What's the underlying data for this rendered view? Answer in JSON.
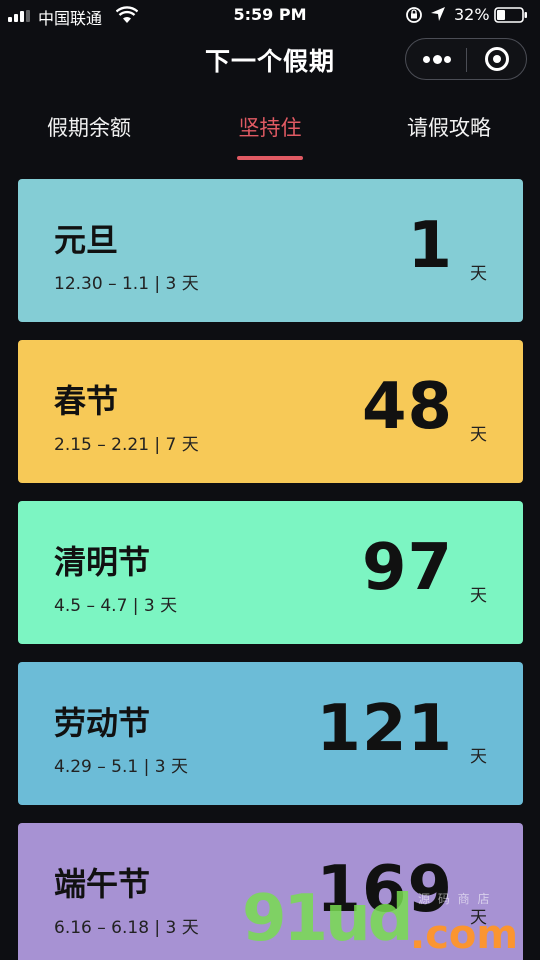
{
  "status_bar": {
    "carrier": "中国联通",
    "time": "5:59 PM",
    "battery": "32%"
  },
  "header": {
    "title": "下一个假期"
  },
  "tabs": [
    {
      "label": "假期余额",
      "active": false
    },
    {
      "label": "坚持住",
      "active": true
    },
    {
      "label": "请假攻略",
      "active": false
    }
  ],
  "colors": {
    "accent": "#e05a63",
    "background": "#0d0e12"
  },
  "holidays": [
    {
      "name": "元旦",
      "dates": "12.30 – 1.1 | 3 天",
      "days": "1",
      "unit": "天",
      "color": "#84cdd5"
    },
    {
      "name": "春节",
      "dates": "2.15 – 2.21 | 7 天",
      "days": "48",
      "unit": "天",
      "color": "#f7c957"
    },
    {
      "name": "清明节",
      "dates": "4.5 – 4.7 | 3 天",
      "days": "97",
      "unit": "天",
      "color": "#7cf5c2"
    },
    {
      "name": "劳动节",
      "dates": "4.29 – 5.1 | 3 天",
      "days": "121",
      "unit": "天",
      "color": "#6cbcd7"
    },
    {
      "name": "端午节",
      "dates": "6.16 – 6.18 | 3 天",
      "days": "169",
      "unit": "天",
      "color": "#a792d3"
    }
  ],
  "watermark": {
    "logo_text": "91ud",
    "suffix": ".com",
    "small_text": "源 码 商 店"
  }
}
